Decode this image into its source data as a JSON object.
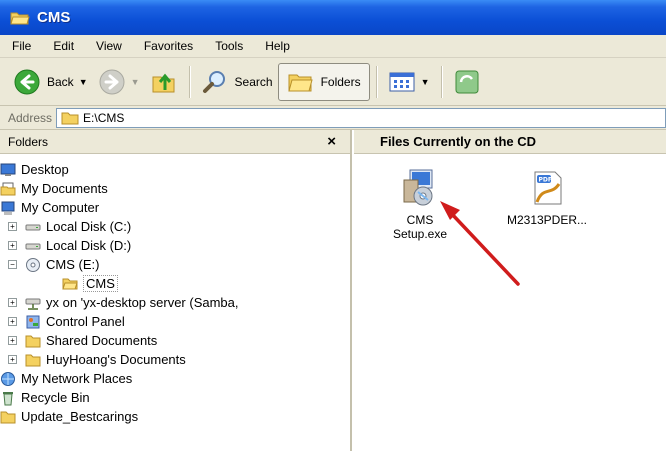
{
  "window": {
    "title": "CMS"
  },
  "menu": [
    "File",
    "Edit",
    "View",
    "Favorites",
    "Tools",
    "Help"
  ],
  "toolbar": {
    "back_label": "Back",
    "search_label": "Search",
    "folders_label": "Folders"
  },
  "address": {
    "label": "Address",
    "value": "E:\\CMS"
  },
  "folders_pane": {
    "title": "Folders",
    "close_glyph": "×",
    "tree": [
      {
        "label": "Desktop",
        "icon": "desktop-icon",
        "expander": "",
        "indent": 0
      },
      {
        "label": "My Documents",
        "icon": "my-documents-icon",
        "expander": "",
        "indent": 0
      },
      {
        "label": "My Computer",
        "icon": "my-computer-icon",
        "expander": "",
        "indent": 0
      },
      {
        "label": "Local Disk (C:)",
        "icon": "drive-icon",
        "expander": "+",
        "indent": 1
      },
      {
        "label": "Local Disk (D:)",
        "icon": "drive-icon",
        "expander": "+",
        "indent": 1
      },
      {
        "label": "CMS (E:)",
        "icon": "cd-drive-icon",
        "expander": "−",
        "indent": 1
      },
      {
        "label": "CMS",
        "icon": "folder-open-icon",
        "expander": "",
        "indent": 2,
        "selected": true
      },
      {
        "label": "yx on 'yx-desktop server (Samba,",
        "icon": "network-drive-icon",
        "expander": "+",
        "indent": 1
      },
      {
        "label": "Control Panel",
        "icon": "control-panel-icon",
        "expander": "+",
        "indent": 1
      },
      {
        "label": "Shared Documents",
        "icon": "folder-icon",
        "expander": "+",
        "indent": 1
      },
      {
        "label": "HuyHoang's Documents",
        "icon": "folder-icon",
        "expander": "+",
        "indent": 1
      },
      {
        "label": "My Network Places",
        "icon": "network-places-icon",
        "expander": "",
        "indent": 0
      },
      {
        "label": "Recycle Bin",
        "icon": "recycle-bin-icon",
        "expander": "",
        "indent": 0
      },
      {
        "label": "Update_Bestcarings",
        "icon": "folder-icon",
        "expander": "",
        "indent": 0
      }
    ]
  },
  "content": {
    "header": "Files Currently on the CD",
    "files": [
      {
        "line1": "CMS",
        "line2": "Setup.exe",
        "icon": "setup-exe-icon"
      },
      {
        "line1": "M2313PDER...",
        "line2": "",
        "icon": "pdf-icon"
      }
    ]
  },
  "colors": {
    "titlebar": "#0b4fd6",
    "chrome": "#ece9d8",
    "annotation_arrow": "#d01c1c"
  }
}
